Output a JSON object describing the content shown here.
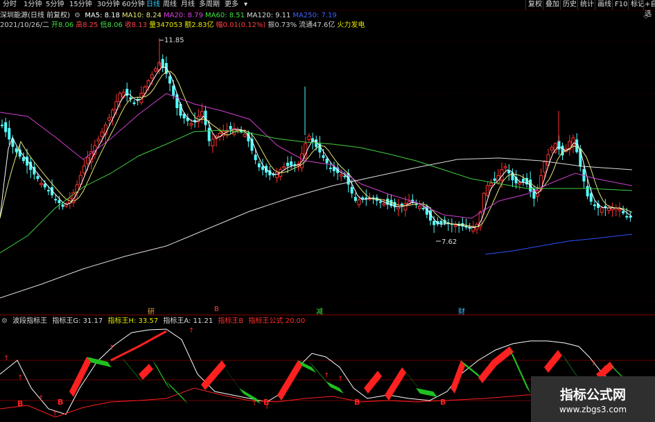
{
  "timeframes": [
    "分时",
    "1分钟",
    "5分钟",
    "15分钟",
    "30分钟",
    "60分钟",
    "日线",
    "周线",
    "月线",
    "多周期",
    "更多"
  ],
  "active_timeframe": "日线",
  "right_buttons": [
    "复权",
    "叠加",
    "历史",
    "统计",
    "画线",
    "F10",
    "标记",
    "+自选"
  ],
  "header": {
    "stock": "深圳能源(日线 前复权)",
    "ma": [
      {
        "label": "MA5: 8.18",
        "color": "#ffffff"
      },
      {
        "label": "MA10: 8.24",
        "color": "#e8e87a"
      },
      {
        "label": "MA20: 8.79",
        "color": "#e040e0"
      },
      {
        "label": "MA60: 8.51",
        "color": "#40e040"
      },
      {
        "label": "MA120: 9.11",
        "color": "#dddddd"
      },
      {
        "label": "MA250: 7.19",
        "color": "#4060ff"
      }
    ]
  },
  "quote": [
    {
      "t": "2021/10/26/二",
      "c": "#cccccc"
    },
    {
      "t": "开8.06",
      "c": "#40e040"
    },
    {
      "t": "高8.25",
      "c": "#ff4040"
    },
    {
      "t": "低8.06",
      "c": "#40e040"
    },
    {
      "t": "收8.13",
      "c": "#ff4040"
    },
    {
      "t": "量347053",
      "c": "#e8e800"
    },
    {
      "t": "额2.83亿",
      "c": "#e8e800"
    },
    {
      "t": "幅0.01(0.12%)",
      "c": "#ff4040"
    },
    {
      "t": "振0.73%",
      "c": "#cccccc"
    },
    {
      "t": "流通47.6亿",
      "c": "#cccccc"
    },
    {
      "t": "火力发电",
      "c": "#e8e800"
    }
  ],
  "price_labels": {
    "high": "11.85",
    "low": "7.62"
  },
  "events": [
    {
      "t": "研",
      "c": "#e0a040"
    },
    {
      "t": "B",
      "c": "#ff4040"
    },
    {
      "t": "减",
      "c": "#40e040"
    },
    {
      "t": "财",
      "c": "#40c0ff"
    }
  ],
  "indicator": {
    "name": "波段指标王",
    "g": "指标王G: 31.17",
    "h": "指标王H: 33.57",
    "a": "指标王A: 11.21",
    "b": "指标王B",
    "formula": "指标王公式 20.00"
  },
  "signal_letter": "B",
  "watermark": {
    "title": "指标公式网",
    "url": "www.zbgs3.com"
  },
  "colors": {
    "up": "#ff3333",
    "down": "#54ffff",
    "ind_red": "#ff2020",
    "ind_green": "#20c020",
    "grid": "#800000"
  }
}
